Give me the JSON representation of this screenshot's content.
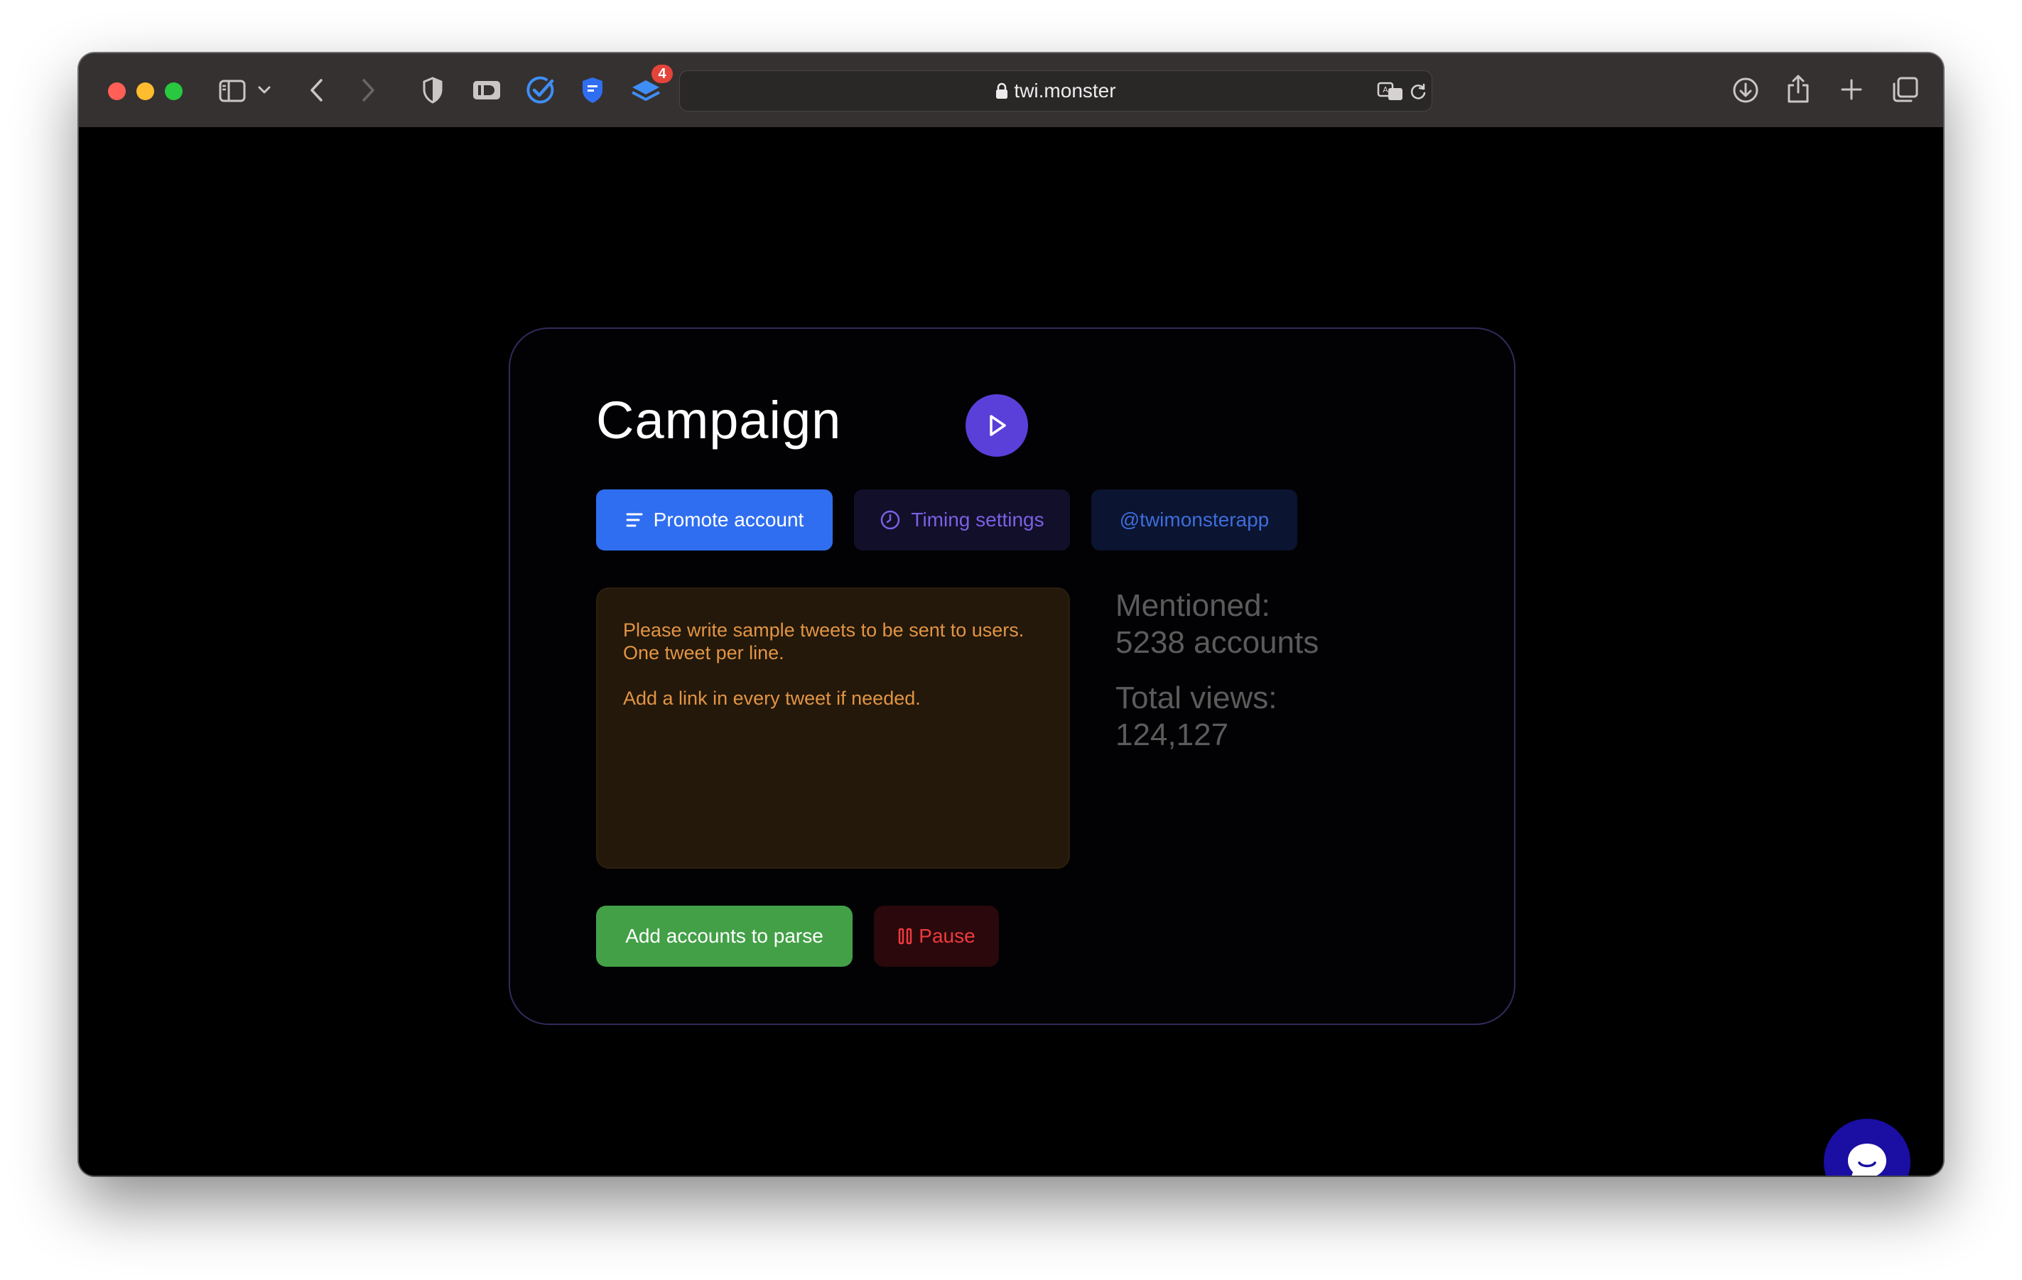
{
  "browser": {
    "url": "twi.monster",
    "extension_badge": "4",
    "icons": [
      "sidebar-icon",
      "chevron-down-icon",
      "back-icon",
      "forward-icon",
      "shield-icon",
      "id-icon",
      "check-icon",
      "bookmark-shield-icon",
      "layers-icon",
      "translate-icon",
      "reload-icon",
      "download-icon",
      "share-icon",
      "plus-icon",
      "tabs-icon"
    ]
  },
  "campaign": {
    "title": "Campaign",
    "tabs": {
      "promote": "Promote account",
      "timing": "Timing settings",
      "handle": "@twimonsterapp"
    },
    "tweets_placeholder": "Please write sample tweets to be sent to users. One tweet per line.\n\nAdd a link in every tweet if needed.",
    "stats": {
      "mentioned_label": "Mentioned:",
      "mentioned_value": "5238 accounts",
      "views_label": "Total views:",
      "views_value": "124,127"
    },
    "buttons": {
      "add_accounts": "Add accounts to parse",
      "pause": "Pause"
    }
  },
  "colors": {
    "accent_purple": "#5a3fd9",
    "promote_blue": "#2f6ef0",
    "add_green": "#43a047",
    "pause_red": "#ef3b3b",
    "placeholder_orange": "#e29445",
    "chat_blue": "#1b0ea3"
  }
}
